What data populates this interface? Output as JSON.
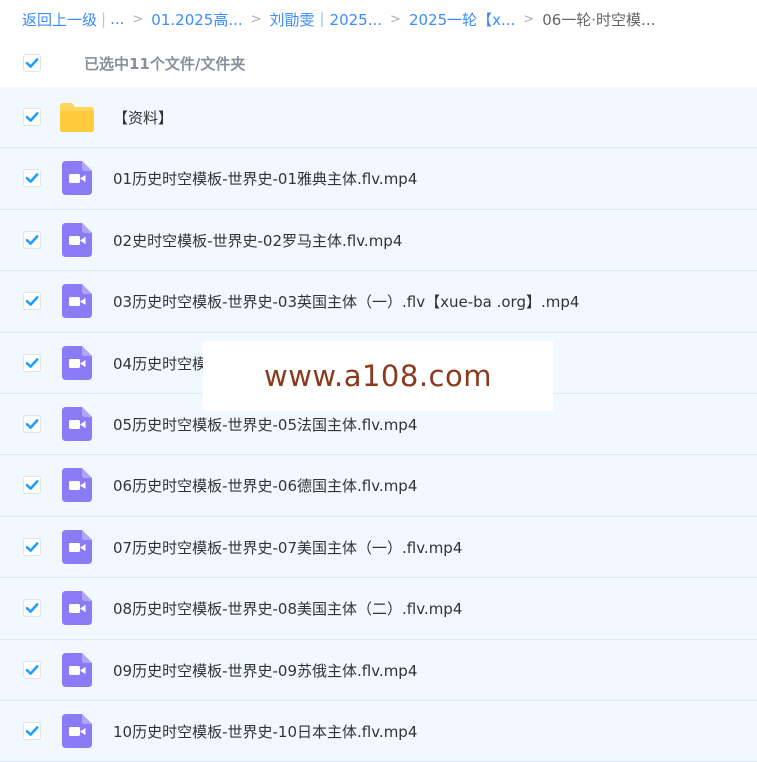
{
  "breadcrumb": {
    "back_label": "返回上一级",
    "pipe": "|",
    "ellipsis": "...",
    "crumbs": [
      "01.2025高...",
      "刘勖雯｜2025...",
      "2025一轮【x...",
      "06一轮·时空模..."
    ]
  },
  "selection": {
    "label": "已选中11个文件/文件夹",
    "checked": true
  },
  "files": [
    {
      "name": "【资料】",
      "type": "folder",
      "checked": true
    },
    {
      "name": "01历史时空模板-世界史-01雅典主体.flv.mp4",
      "type": "video",
      "checked": true
    },
    {
      "name": "02史时空模板-世界史-02罗马主体.flv.mp4",
      "type": "video",
      "checked": true
    },
    {
      "name": "03历史时空模板-世界史-03英国主体（一）.flv【xue-ba .org】.mp4",
      "type": "video",
      "checked": true
    },
    {
      "name": "04历史时空模板-世界史-04...",
      "type": "video",
      "checked": true
    },
    {
      "name": "05历史时空模板-世界史-05法国主体.flv.mp4",
      "type": "video",
      "checked": true
    },
    {
      "name": "06历史时空模板-世界史-06德国主体.flv.mp4",
      "type": "video",
      "checked": true
    },
    {
      "name": "07历史时空模板-世界史-07美国主体（一）.flv.mp4",
      "type": "video",
      "checked": true
    },
    {
      "name": "08历史时空模板-世界史-08美国主体（二）.flv.mp4",
      "type": "video",
      "checked": true
    },
    {
      "name": "09历史时空模板-世界史-09苏俄主体.flv.mp4",
      "type": "video",
      "checked": true
    },
    {
      "name": "10历史时空模板-世界史-10日本主体.flv.mp4",
      "type": "video",
      "checked": true
    }
  ],
  "watermark": {
    "text": "www.a108.com"
  },
  "colors": {
    "link": "#3b8cff",
    "checkbox": "#1e9fff",
    "row_bg": "#f2f8ff",
    "folder": "#ffd65c",
    "video": "#8b7cf6",
    "watermark": "#8b3a1e"
  }
}
